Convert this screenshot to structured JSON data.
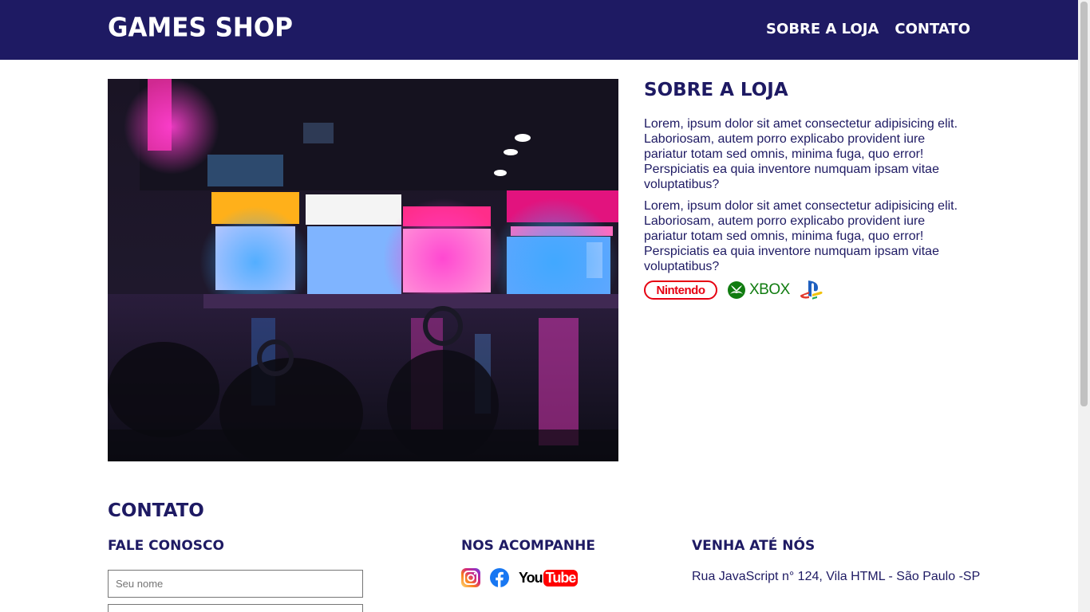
{
  "header": {
    "brand": "GAMES SHOP",
    "nav": [
      {
        "label": "SOBRE A LOJA"
      },
      {
        "label": "CONTATO"
      }
    ]
  },
  "about": {
    "title": "SOBRE A LOJA",
    "paragraphs": [
      "Lorem, ipsum dolor sit amet consectetur adipisicing elit. Laboriosam, autem porro explicabo provident iure pariatur totam sed omnis, minima fuga, quo error! Perspiciatis ea quia inventore numquam ipsam vitae voluptatibus?",
      "Lorem, ipsum dolor sit amet consectetur adipisicing elit. Laboriosam, autem porro explicabo provident iure pariatur totam sed omnis, minima fuga, quo error! Perspiciatis ea quia inventore numquam ipsam vitae voluptatibus?"
    ],
    "brand_logos": {
      "nintendo": "Nintendo",
      "xbox": "XBOX",
      "playstation_icon": "playstation-icon"
    }
  },
  "contact": {
    "title": "CONTATO",
    "form_title": "FALE CONOSCO",
    "name_placeholder": "Seu nome",
    "follow_title": "NOS ACOMPANHE",
    "social_icons": [
      "instagram-icon",
      "facebook-icon",
      "youtube-icon"
    ],
    "youtube_label": "YouTube",
    "visit_title": "VENHA ATÉ NÓS",
    "address": "Rua JavaScript n° 124, Vila HTML - São Paulo -SP"
  },
  "colors": {
    "primary": "#1e1a63",
    "nintendo_red": "#e60012",
    "xbox_green": "#107c10"
  }
}
